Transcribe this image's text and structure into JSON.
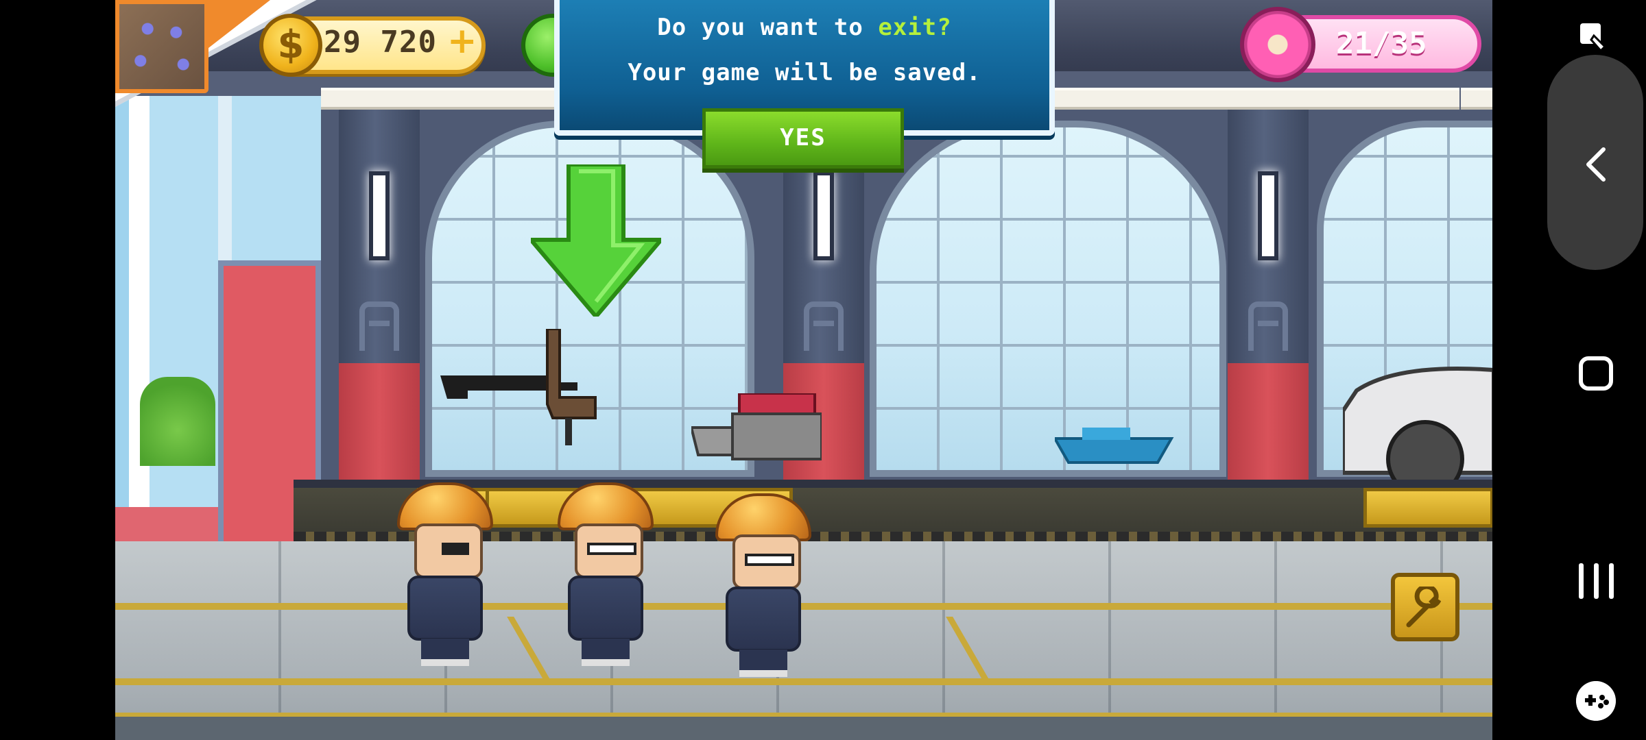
{
  "hud": {
    "coins": "29 720",
    "coin_symbol": "$",
    "coin_plus": "+",
    "donuts": "21/35"
  },
  "dialog": {
    "line1_prefix": "Do you want to ",
    "line1_accent": "exit?",
    "line2": "Your game will be saved.",
    "yes_label": "YES",
    "accent_color": "#b4f03c"
  },
  "icons": {
    "coin": "dollar-coin-icon",
    "cash": "green-cash-icon",
    "donut": "donut-icon",
    "wrench": "wrench-icon",
    "arrow": "down-arrow-icon"
  },
  "nav": {
    "items": [
      "screenshot-icon",
      "back-icon",
      "home-icon",
      "recents-icon",
      "game-tools-icon"
    ]
  },
  "colors": {
    "dialog_bg": "#0f5f92",
    "yes_green": "#5fb51a",
    "coin_gold": "#f0b31c",
    "donut_pink": "#ff5fb4"
  }
}
